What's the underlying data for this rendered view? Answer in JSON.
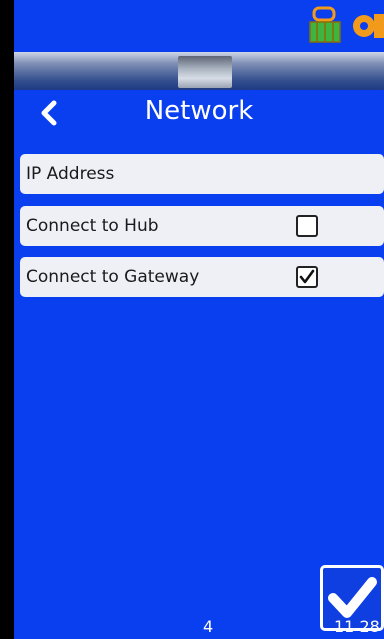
{
  "header": {
    "title": "Network"
  },
  "settings": {
    "ip_label": "IP Address",
    "hub_label": "Connect to Hub",
    "hub_checked": false,
    "gateway_label": "Connect to Gateway",
    "gateway_checked": true
  },
  "footer": {
    "page": "4",
    "time": "11 28"
  },
  "colors": {
    "background": "#0a3ff0",
    "row": "#eef0f6",
    "status_icon": "#f29a1b",
    "battery": "#3fb43f"
  }
}
